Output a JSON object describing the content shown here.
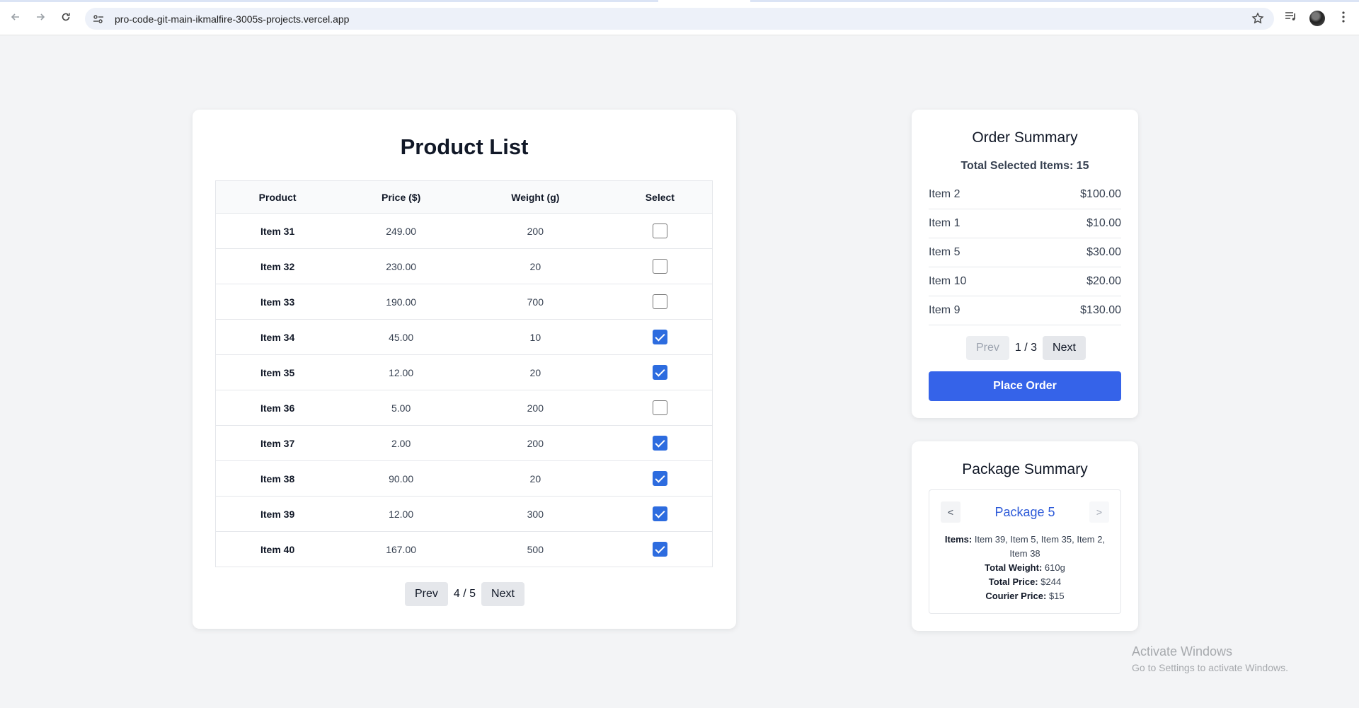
{
  "browser": {
    "url": "pro-code-git-main-ikmalfire-3005s-projects.vercel.app"
  },
  "product_list": {
    "title": "Product List",
    "columns": [
      "Product",
      "Price ($)",
      "Weight (g)",
      "Select"
    ],
    "rows": [
      {
        "product": "Item 31",
        "price": "249.00",
        "weight": "200",
        "selected": false
      },
      {
        "product": "Item 32",
        "price": "230.00",
        "weight": "20",
        "selected": false
      },
      {
        "product": "Item 33",
        "price": "190.00",
        "weight": "700",
        "selected": false
      },
      {
        "product": "Item 34",
        "price": "45.00",
        "weight": "10",
        "selected": true
      },
      {
        "product": "Item 35",
        "price": "12.00",
        "weight": "20",
        "selected": true
      },
      {
        "product": "Item 36",
        "price": "5.00",
        "weight": "200",
        "selected": false
      },
      {
        "product": "Item 37",
        "price": "2.00",
        "weight": "200",
        "selected": true
      },
      {
        "product": "Item 38",
        "price": "90.00",
        "weight": "20",
        "selected": true
      },
      {
        "product": "Item 39",
        "price": "12.00",
        "weight": "300",
        "selected": true
      },
      {
        "product": "Item 40",
        "price": "167.00",
        "weight": "500",
        "selected": true
      }
    ],
    "pagination": {
      "prev_label": "Prev",
      "page_text": "4 / 5",
      "next_label": "Next"
    }
  },
  "order_summary": {
    "title": "Order Summary",
    "total_text": "Total Selected Items: 15",
    "items": [
      {
        "name": "Item 2",
        "price": "$100.00"
      },
      {
        "name": "Item 1",
        "price": "$10.00"
      },
      {
        "name": "Item 5",
        "price": "$30.00"
      },
      {
        "name": "Item 10",
        "price": "$20.00"
      },
      {
        "name": "Item 9",
        "price": "$130.00"
      }
    ],
    "pagination": {
      "prev_label": "Prev",
      "page_text": "1 / 3",
      "next_label": "Next"
    },
    "place_order_label": "Place Order"
  },
  "package_summary": {
    "title": "Package Summary",
    "prev_label": "<",
    "next_label": ">",
    "package_name": "Package 5",
    "items_label": "Items:",
    "items_value": "Item 39, Item 5, Item 35, Item 2, Item 38",
    "weight_label": "Total Weight:",
    "weight_value": "610g",
    "price_label": "Total Price:",
    "price_value": "$244",
    "courier_label": "Courier Price:",
    "courier_value": "$15"
  },
  "watermark": {
    "line1": "Activate Windows",
    "line2": "Go to Settings to activate Windows."
  }
}
